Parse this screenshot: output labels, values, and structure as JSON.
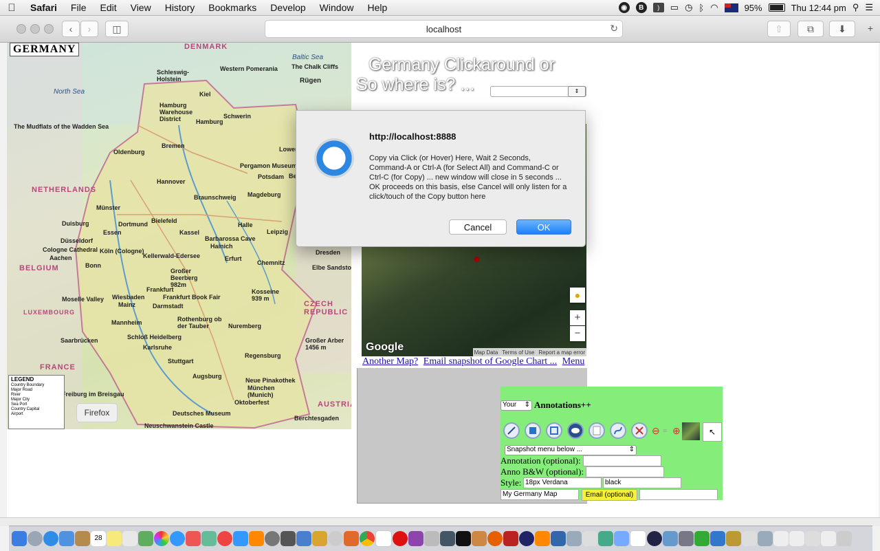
{
  "menubar": {
    "app": "Safari",
    "items": [
      "File",
      "Edit",
      "View",
      "History",
      "Bookmarks",
      "Develop",
      "Window",
      "Help"
    ],
    "battery": "95%",
    "clock": "Thu 12:44 pm"
  },
  "toolbar": {
    "url": "localhost"
  },
  "map": {
    "heading": "GERMANY",
    "seas": [
      "North Sea",
      "Baltic Sea"
    ],
    "countries": [
      "DENMARK",
      "NETHERLANDS",
      "BELGIUM",
      "LUXEMBOURG",
      "FRANCE",
      "CZECH REPUBLIC",
      "AUSTRIA"
    ],
    "places": [
      "Kiel",
      "Hamburg",
      "Schwerin",
      "Bremen",
      "Oldenburg",
      "Hannover",
      "Berlin",
      "Potsdam",
      "Magdeburg",
      "Münster",
      "Bielefeld",
      "Dortmund",
      "Essen",
      "Düsseldorf",
      "Köln (Cologne)",
      "Bonn",
      "Kassel",
      "Leipzig",
      "Dresden",
      "Erfurt",
      "Halle",
      "Chemnitz",
      "Frankfurt",
      "Wiesbaden",
      "Mainz",
      "Darmstadt",
      "Mannheim",
      "Saarbrücken",
      "Stuttgart",
      "Nuremberg",
      "Regensburg",
      "Augsburg",
      "München (Munich)",
      "Freiburg im Breisgau",
      "Karlsruhe",
      "Aachen",
      "Duisburg",
      "Braunschweig",
      "The Chalk Cliffs",
      "Rügen",
      "The Mudflats of the Wadden Sea",
      "Pergamon Museum",
      "Barbarossa Cave",
      "Frankfurt Book Fair",
      "Schloß Heidelberg",
      "Neue Pinakothek",
      "Deutsches Museum",
      "Oktoberfest",
      "Berchtesgaden",
      "Neuschwanstein Castle",
      "Großer Arber 1456 m",
      "Großer Beerberg 982m",
      "Kosseine 939 m",
      "Rothenburg ob der Tauber",
      "Moselle Valley",
      "Western Pomerania",
      "Hamburg Warehouse District",
      "Schleswig-Holstein",
      "Lower Oder Valley",
      "Cologne Cathedral",
      "Elbe Sandstone",
      "Kellerwald-Edersee",
      "Hainich"
    ],
    "legend": {
      "title": "LEGEND",
      "items": [
        "Country Boundary",
        "Major Road",
        "River",
        "Major City",
        "Sea Port",
        "Country Capital",
        "Airport"
      ]
    },
    "firefox_button": "Firefox"
  },
  "title": {
    "line1": "Germany Clickaround or",
    "line2": "So where is? ..."
  },
  "google_map": {
    "logo": "Google",
    "attribution": [
      "Map Data",
      "Terms of Use",
      "Report a map error"
    ]
  },
  "links": [
    "Another Map?",
    "Email snapshot of Google Chart ...",
    "Menu"
  ],
  "annotations": {
    "owner_select": "Your",
    "heading": "Annotations++",
    "snapshot_select": "Snapshot menu below ...",
    "annotation_label": "Annotation (optional):",
    "anno_bw_label": "Anno B&W (optional):",
    "style_label": "Style:",
    "style_font": "18px Verdana",
    "style_color": "black",
    "map_name": "My Germany Map",
    "email_button": "Email (optional)"
  },
  "dialog": {
    "origin": "http://localhost:8888",
    "message": "Copy via Click (or Hover) Here, Wait 2 Seconds, Command-A or Ctrl-A (for Select All) and Command-C or Ctrl-C (for Copy) ... new window will close in 5 seconds ... OK proceeds on this basis, else Cancel will only listen for a click/touch of the Copy button here",
    "cancel": "Cancel",
    "ok": "OK"
  },
  "dock": {
    "calendar_day": "28"
  }
}
